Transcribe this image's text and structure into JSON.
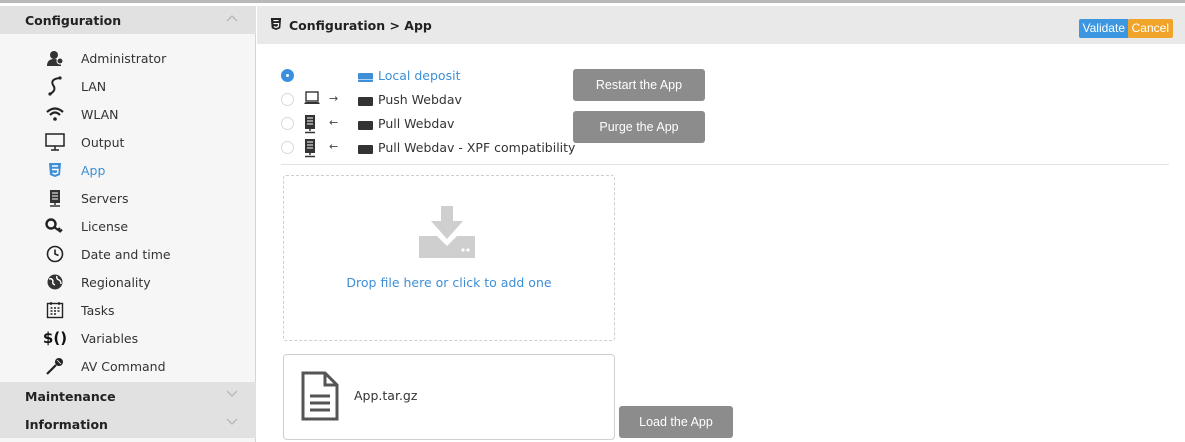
{
  "sidebar": {
    "config_header": "Configuration",
    "items": [
      {
        "label": "Administrator",
        "icon": "admin-user-icon"
      },
      {
        "label": "LAN",
        "icon": "lan-icon"
      },
      {
        "label": "WLAN",
        "icon": "wifi-icon"
      },
      {
        "label": "Output",
        "icon": "monitor-icon"
      },
      {
        "label": "App",
        "icon": "html5-icon"
      },
      {
        "label": "Servers",
        "icon": "server-icon"
      },
      {
        "label": "License",
        "icon": "key-icon"
      },
      {
        "label": "Date and time",
        "icon": "clock-icon"
      },
      {
        "label": "Regionality",
        "icon": "globe-icon"
      },
      {
        "label": "Tasks",
        "icon": "calendar-icon"
      },
      {
        "label": "Variables",
        "icon": "variables-icon"
      },
      {
        "label": "AV Command",
        "icon": "microphone-icon"
      }
    ],
    "active_item": "App",
    "maintenance_header": "Maintenance",
    "information_header": "Information"
  },
  "header": {
    "title": "Configuration > App",
    "validate_label": "Validate",
    "cancel_label": "Cancel"
  },
  "sources": {
    "options": [
      {
        "label": "Local deposit",
        "checked": true,
        "arrow": ""
      },
      {
        "label": "Push Webdav",
        "checked": false,
        "arrow": "→"
      },
      {
        "label": "Pull Webdav",
        "checked": false,
        "arrow": "←"
      },
      {
        "label": "Pull Webdav - XPF compatibility",
        "checked": false,
        "arrow": "←"
      }
    ]
  },
  "actions": {
    "restart_label": "Restart the App",
    "purge_label": "Purge the App",
    "load_label": "Load the App"
  },
  "dropzone": {
    "text": "Drop file here or click to add one"
  },
  "file": {
    "name": "App.tar.gz"
  },
  "colors": {
    "accent_blue": "#3e8fd6",
    "validate": "#3c97e0",
    "cancel": "#f0a52a",
    "gray_button": "#8c8c8c"
  }
}
